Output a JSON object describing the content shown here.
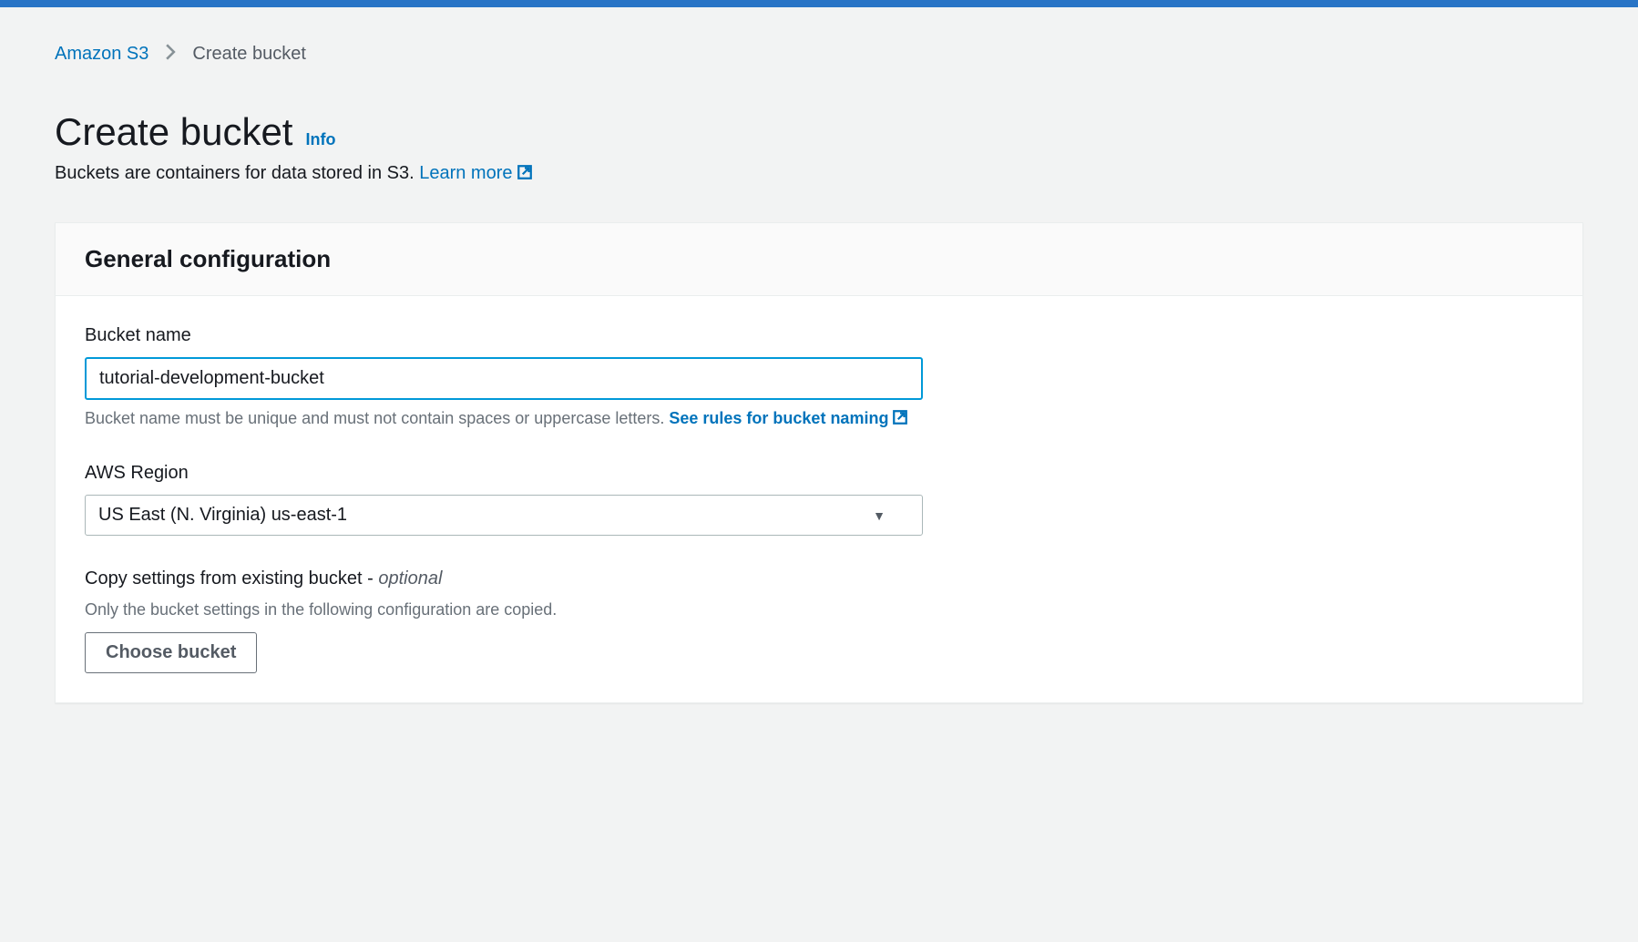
{
  "breadcrumb": {
    "root": "Amazon S3",
    "current": "Create bucket"
  },
  "header": {
    "title": "Create bucket",
    "info_label": "Info",
    "subtitle_prefix": "Buckets are containers for data stored in S3. ",
    "learn_more": "Learn more"
  },
  "panel": {
    "title": "General configuration",
    "bucket_name": {
      "label": "Bucket name",
      "value": "tutorial-development-bucket",
      "help_prefix": "Bucket name must be unique and must not contain spaces or uppercase letters. ",
      "rules_link": "See rules for bucket naming"
    },
    "region": {
      "label": "AWS Region",
      "value": "US East (N. Virginia) us-east-1"
    },
    "copy_settings": {
      "label_prefix": "Copy settings from existing bucket - ",
      "label_optional": "optional",
      "sublabel": "Only the bucket settings in the following configuration are copied.",
      "button": "Choose bucket"
    }
  },
  "colors": {
    "accent": "#0073bb",
    "focus": "#0099d8"
  }
}
